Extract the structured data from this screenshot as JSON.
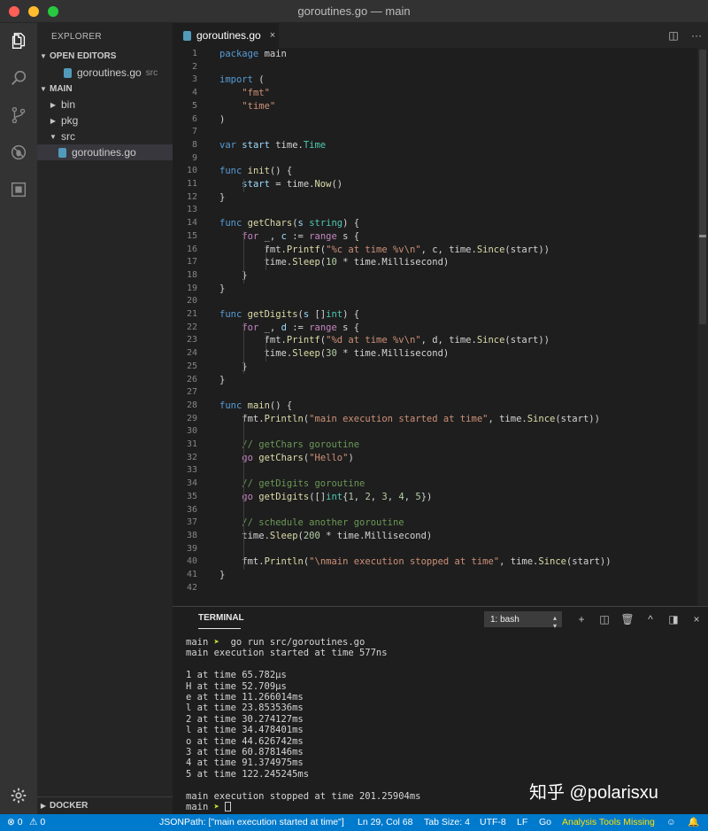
{
  "window": {
    "title": "goroutines.go — main"
  },
  "activity_bar": {
    "items": [
      {
        "name": "explorer-icon"
      },
      {
        "name": "search-icon"
      },
      {
        "name": "source-control-icon"
      },
      {
        "name": "debug-icon"
      },
      {
        "name": "extensions-icon"
      }
    ],
    "settings_icon": "gear-icon"
  },
  "sidebar": {
    "title": "EXPLORER",
    "open_editors": {
      "label": "OPEN EDITORS",
      "items": [
        {
          "name": "goroutines.go",
          "desc": "src"
        }
      ]
    },
    "main": {
      "label": "MAIN",
      "items": [
        {
          "label": "bin",
          "twisty": "▶"
        },
        {
          "label": "pkg",
          "twisty": "▶"
        },
        {
          "label": "src",
          "twisty": "▼"
        },
        {
          "label": "goroutines.go",
          "twisty": ""
        }
      ]
    },
    "docker_label": "DOCKER"
  },
  "tab": {
    "label": "goroutines.go",
    "close": "×"
  },
  "editor": {
    "lines": [
      "<span class=\"k\">package</span> main",
      "",
      "<span class=\"k\">import</span> (",
      "    <span class=\"s\">\"fmt\"</span>",
      "    <span class=\"s\">\"time\"</span>",
      ")",
      "",
      "<span class=\"k\">var</span> <span class=\"v\">start</span> time.<span class=\"t\">Time</span>",
      "",
      "<span class=\"k\">func</span> <span class=\"f\">init</span>() {",
      "    <span class=\"v\">start</span> = time.<span class=\"f\">Now</span>()",
      "}",
      "",
      "<span class=\"k\">func</span> <span class=\"f\">getChars</span>(<span class=\"v\">s</span> <span class=\"t\">string</span>) {",
      "    <span class=\"kc\">for</span> _, <span class=\"v\">c</span> := <span class=\"kc\">range</span> s {",
      "        fmt.<span class=\"f\">Printf</span>(<span class=\"s\">\"%c at time %v\\n\"</span>, c, time.<span class=\"f\">Since</span>(start))",
      "        time.<span class=\"f\">Sleep</span>(<span class=\"n\">10</span> * time.Millisecond)",
      "    }",
      "}",
      "",
      "<span class=\"k\">func</span> <span class=\"f\">getDigits</span>(<span class=\"v\">s</span> []<span class=\"t\">int</span>) {",
      "    <span class=\"kc\">for</span> _, <span class=\"v\">d</span> := <span class=\"kc\">range</span> s {",
      "        fmt.<span class=\"f\">Printf</span>(<span class=\"s\">\"%d at time %v\\n\"</span>, d, time.<span class=\"f\">Since</span>(start))",
      "        time.<span class=\"f\">Sleep</span>(<span class=\"n\">30</span> * time.Millisecond)",
      "    }",
      "}",
      "",
      "<span class=\"k\">func</span> <span class=\"f\">main</span>() {",
      "    fmt.<span class=\"f\">Println</span>(<span class=\"s\">\"main execution started at time\"</span>, time.<span class=\"f\">Since</span>(start))",
      "",
      "    <span class=\"c\">// getChars goroutine</span>",
      "    <span class=\"kc\">go</span> <span class=\"f\">getChars</span>(<span class=\"s\">\"Hello\"</span>)",
      "",
      "    <span class=\"c\">// getDigits goroutine</span>",
      "    <span class=\"kc\">go</span> <span class=\"f\">getDigits</span>([]<span class=\"t\">int</span>{<span class=\"n\">1</span>, <span class=\"n\">2</span>, <span class=\"n\">3</span>, <span class=\"n\">4</span>, <span class=\"n\">5</span>})",
      "",
      "    <span class=\"c\">// schedule another goroutine</span>",
      "    time.<span class=\"f\">Sleep</span>(<span class=\"n\">200</span> * time.Millisecond)",
      "",
      "    fmt.<span class=\"f\">Println</span>(<span class=\"s\">\"\\nmain execution stopped at time\"</span>, time.<span class=\"f\">Since</span>(start))",
      "}",
      ""
    ]
  },
  "panel": {
    "title": "TERMINAL",
    "terminal_select": "1: bash",
    "actions": [
      "+",
      "◫",
      "🗑",
      "^",
      "◨",
      "×"
    ],
    "prompt_label": "main",
    "prompt_arrow": "➤",
    "command": "go run src/goroutines.go",
    "output": [
      "main execution started at time 577ns",
      "",
      "1 at time 65.782µs",
      "H at time 52.709µs",
      "e at time 11.266014ms",
      "l at time 23.853536ms",
      "2 at time 30.274127ms",
      "l at time 34.478401ms",
      "o at time 44.626742ms",
      "3 at time 60.878146ms",
      "4 at time 91.374975ms",
      "5 at time 122.245245ms",
      "",
      "main execution stopped at time 201.25904ms"
    ]
  },
  "watermark": "知乎 @polarisxu",
  "statusbar": {
    "errors": "⊗ 0",
    "warnings": "⚠ 0",
    "jsonpath": "JSONPath: [\"main execution started at time\"]",
    "position": "Ln 29, Col 68",
    "tab_size": "Tab Size: 4",
    "encoding": "UTF-8",
    "eol": "LF",
    "language": "Go",
    "analysis": "Analysis Tools Missing",
    "feedback_icon": "smiley-icon",
    "bell_icon": "bell-icon"
  },
  "colors": {
    "accent": "#007acc",
    "warning": "#ffe000",
    "prompt_arrow": "#cde82f"
  }
}
